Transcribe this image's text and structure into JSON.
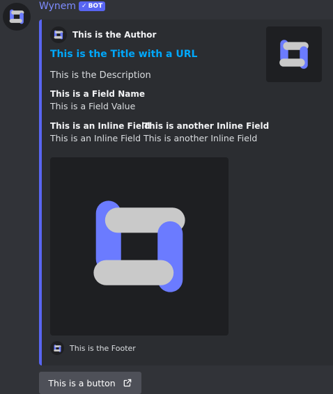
{
  "message": {
    "username": "Wynem",
    "bot_tag": {
      "check": "✓",
      "label": "BOT"
    }
  },
  "embed": {
    "accent_color": "#5865f2",
    "author": {
      "name": "This is the Author"
    },
    "title": "This is the Title with a URL",
    "description": "This is the Description",
    "fields": [
      {
        "name": "This is a Field Name",
        "value": "This is a Field Value"
      },
      {
        "name": "This is an Inline Field",
        "value": "This is an Inline Field"
      },
      {
        "name": "This is another Inline Field",
        "value": "This is another Inline Field"
      }
    ],
    "footer": {
      "text": "This is the Footer"
    }
  },
  "button": {
    "label": "This is a button",
    "icon": "external-link-icon"
  },
  "colors": {
    "background": "#313338",
    "embed_bg": "#2b2d31",
    "username": "#7e8cff",
    "link": "#00a8fc",
    "button_bg": "#4e5058",
    "logo_blue": "#6b7bff",
    "logo_grey": "#c9c9c9"
  }
}
